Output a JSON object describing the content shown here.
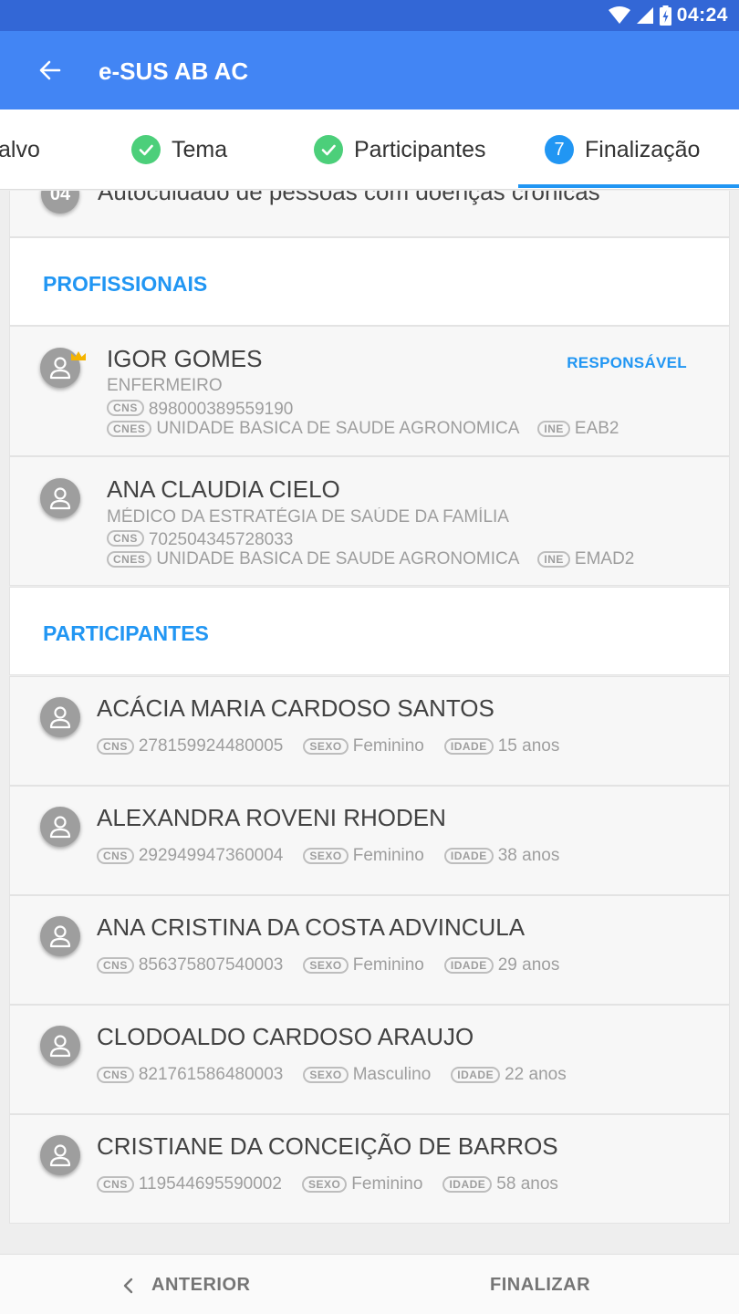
{
  "status_bar": {
    "time": "04:24"
  },
  "app_bar": {
    "title": "e-SUS AB AC"
  },
  "stepper": {
    "steps": [
      {
        "label": "alvo"
      },
      {
        "label": "Tema"
      },
      {
        "label": "Participantes"
      },
      {
        "label": "Finalização",
        "number": "7"
      }
    ]
  },
  "top_item": {
    "number": "04",
    "text": "Autocuidado de pessoas com doenças crônicas"
  },
  "profissionais": {
    "title": "PROFISSIONAIS",
    "items": [
      {
        "name": "IGOR GOMES",
        "role": "ENFERMEIRO",
        "badge": "RESPONSÁVEL",
        "cns_label": "CNS",
        "cns": "898000389559190",
        "cnes_label": "CNES",
        "cnes": "UNIDADE BASICA DE SAUDE AGRONOMICA",
        "ine_label": "INE",
        "ine": "EAB2"
      },
      {
        "name": "ANA CLAUDIA CIELO",
        "role": "MÉDICO DA ESTRATÉGIA DE SAÚDE DA FAMÍLIA",
        "cns_label": "CNS",
        "cns": "702504345728033",
        "cnes_label": "CNES",
        "cnes": "UNIDADE BASICA DE SAUDE AGRONOMICA",
        "ine_label": "INE",
        "ine": "EMAD2"
      }
    ]
  },
  "participantes": {
    "title": "PARTICIPANTES",
    "labels": {
      "cns": "CNS",
      "sexo": "SEXO",
      "idade": "IDADE"
    },
    "items": [
      {
        "name": "ACÁCIA MARIA CARDOSO SANTOS",
        "cns": "278159924480005",
        "sexo": "Feminino",
        "idade": "15 anos"
      },
      {
        "name": "ALEXANDRA ROVENI RHODEN",
        "cns": "292949947360004",
        "sexo": "Feminino",
        "idade": "38 anos"
      },
      {
        "name": "ANA CRISTINA DA COSTA ADVINCULA",
        "cns": "856375807540003",
        "sexo": "Feminino",
        "idade": "29 anos"
      },
      {
        "name": "CLODOALDO CARDOSO ARAUJO",
        "cns": "821761586480003",
        "sexo": "Masculino",
        "idade": "22 anos"
      },
      {
        "name": "CRISTIANE DA CONCEIÇÃO DE BARROS",
        "cns": "119544695590002",
        "sexo": "Feminino",
        "idade": "58 anos"
      }
    ]
  },
  "bottom_nav": {
    "previous": "ANTERIOR",
    "finish": "FINALIZAR"
  },
  "colors": {
    "primary": "#4285f4",
    "status_bar": "#3367d6",
    "accent": "#2196f3",
    "check": "#4ccf7a"
  },
  "icons": [
    "wifi-icon",
    "signal-icon",
    "battery-icon",
    "back-arrow-icon",
    "check-icon",
    "person-icon",
    "crown-icon",
    "chevron-left-icon"
  ]
}
